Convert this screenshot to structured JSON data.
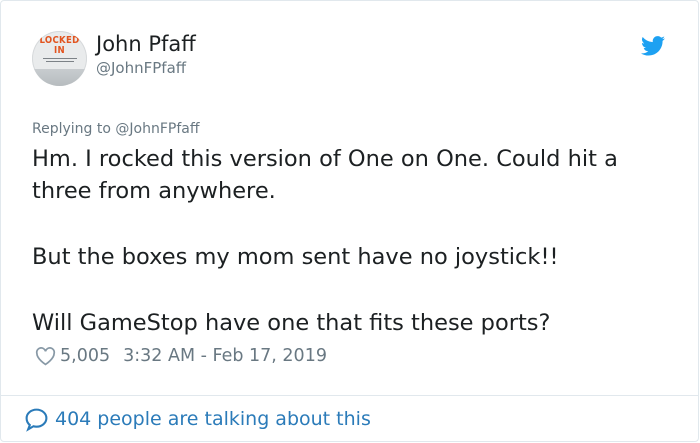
{
  "author": {
    "name": "John Pfaff",
    "handle": "@JohnFPfaff",
    "avatar_text_top": "LOCKED\nIN"
  },
  "reply": {
    "label": "Replying to @JohnFPfaff"
  },
  "tweet": {
    "paragraph_1": "Hm. I rocked this version of One on One. Could hit a three from anywhere.",
    "paragraph_2": "But the boxes my mom sent have no joystick!!",
    "paragraph_3": "Will GameStop have one that fits these ports?"
  },
  "meta": {
    "likes": "5,005",
    "timestamp": "3:32 AM - Feb 17, 2019"
  },
  "footer": {
    "conversation": "404 people are talking about this"
  },
  "icons": {
    "brand": "twitter-bird-icon",
    "like": "heart-icon",
    "conversation": "speech-bubble-icon"
  },
  "colors": {
    "twitter_blue": "#1da1f2",
    "link_blue": "#2b7bb9",
    "secondary_text": "#697882",
    "avatar_accent": "#e2541f"
  }
}
